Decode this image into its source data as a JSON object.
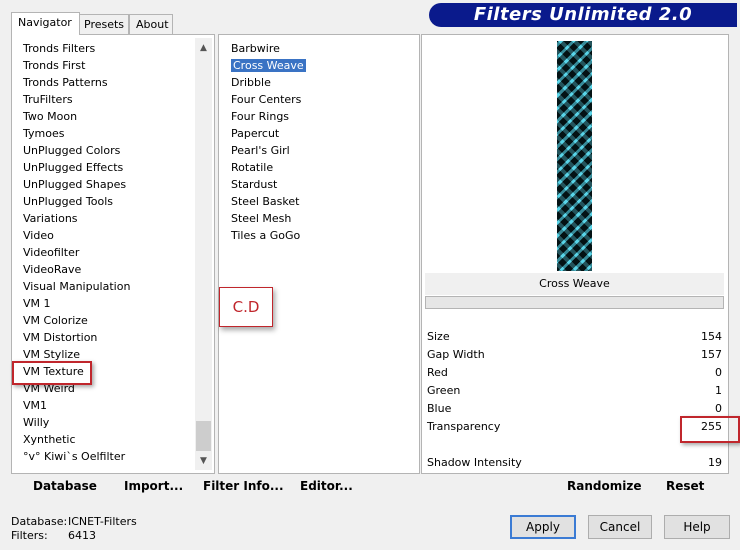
{
  "title": "Filters Unlimited 2.0",
  "tabs": [
    "Navigator",
    "Presets",
    "About"
  ],
  "categories": [
    "Tronds Filters",
    "Tronds First",
    "Tronds Patterns",
    "TruFilters",
    "Two Moon",
    "Tymoes",
    "UnPlugged Colors",
    "UnPlugged Effects",
    "UnPlugged Shapes",
    "UnPlugged Tools",
    "Variations",
    "Video",
    "Videofilter",
    "VideoRave",
    "Visual Manipulation",
    "VM 1",
    "VM Colorize",
    "VM Distortion",
    "VM Stylize",
    "VM Texture",
    "VM Weird",
    "VM1",
    "Willy",
    "Xynthetic",
    "°v° Kiwi`s Oelfilter"
  ],
  "filters": [
    "Barbwire",
    "Cross Weave",
    "Dribble",
    "Four Centers",
    "Four Rings",
    "Papercut",
    "Pearl's Girl",
    "Rotatile",
    "Stardust",
    "Steel Basket",
    "Steel Mesh",
    "Tiles a GoGo"
  ],
  "selected_filter": "Cross Weave",
  "annotation": "C.D",
  "preview_label": "Cross Weave",
  "params": {
    "size": {
      "label": "Size",
      "value": "154"
    },
    "gap": {
      "label": "Gap Width",
      "value": "157"
    },
    "red": {
      "label": "Red",
      "value": "0"
    },
    "green": {
      "label": "Green",
      "value": "1"
    },
    "blue": {
      "label": "Blue",
      "value": "0"
    },
    "transparency": {
      "label": "Transparency",
      "value": "255"
    },
    "shadow": {
      "label": "Shadow Intensity",
      "value": "19"
    }
  },
  "links": {
    "database": "Database",
    "import": "Import...",
    "filter_info": "Filter Info...",
    "editor": "Editor...",
    "randomize": "Randomize",
    "reset": "Reset"
  },
  "status": {
    "database_label": "Database:",
    "database_value": "ICNET-Filters",
    "filters_label": "Filters:",
    "filters_value": "6413"
  },
  "buttons": {
    "apply": "Apply",
    "cancel": "Cancel",
    "help": "Help"
  }
}
